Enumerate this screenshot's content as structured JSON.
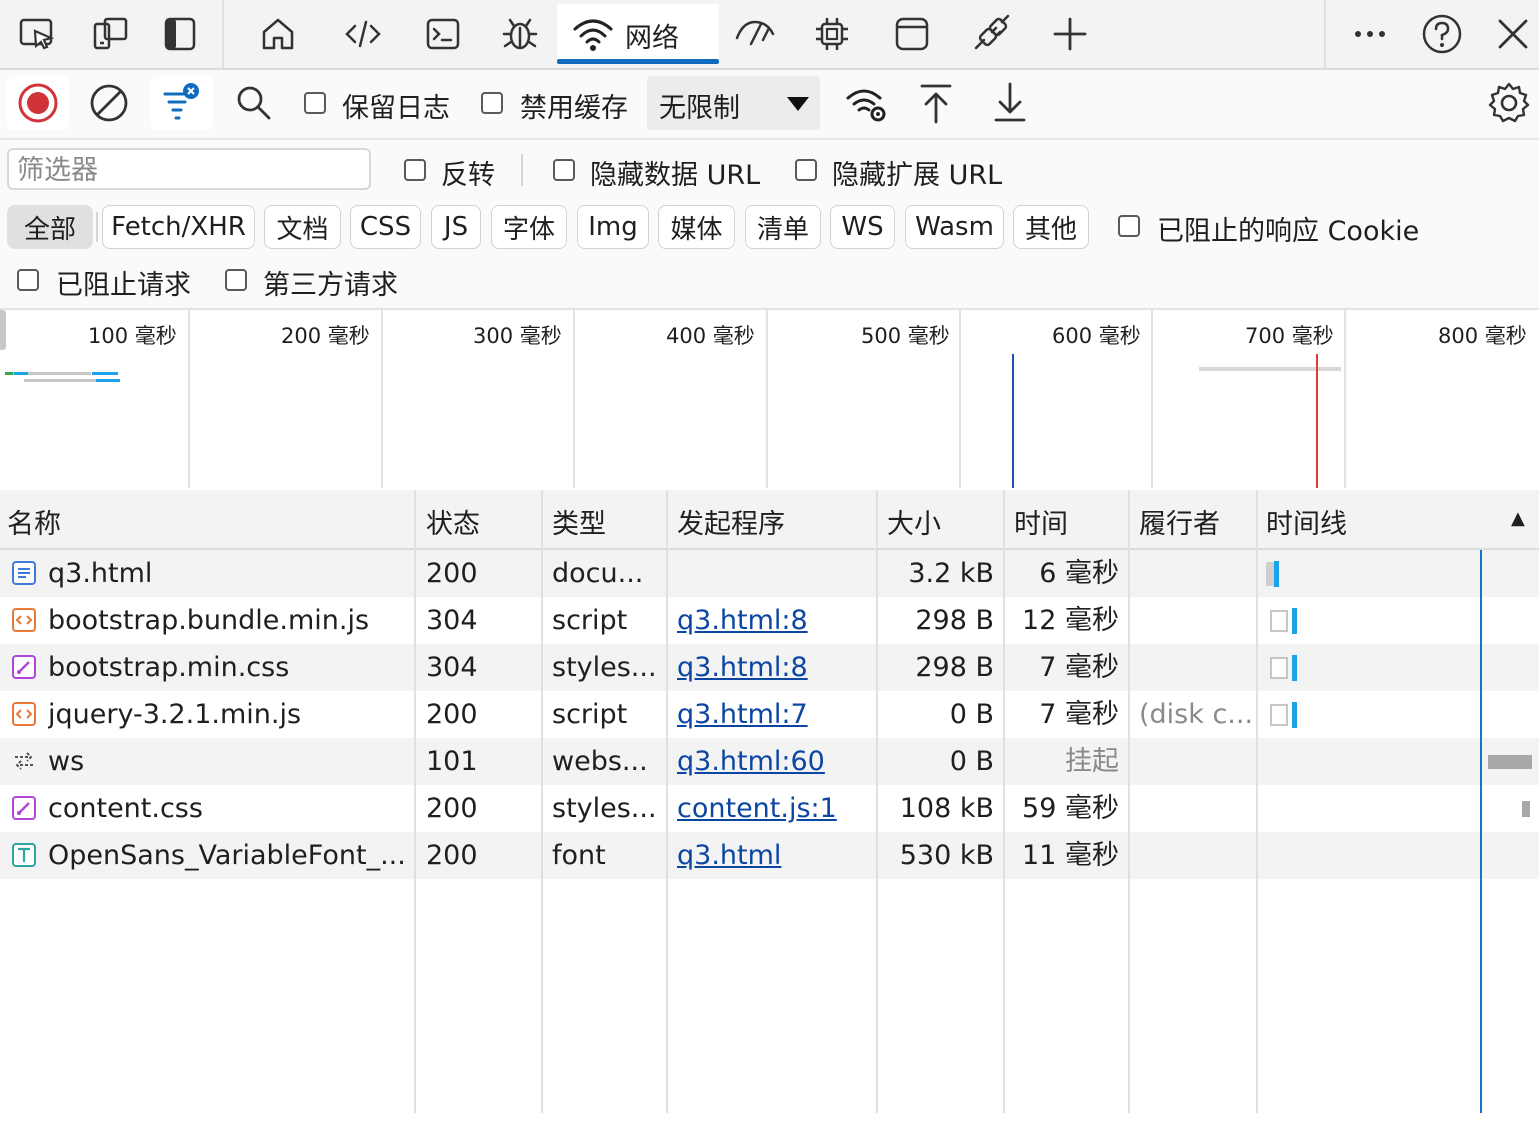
{
  "tabs": {
    "active_label": "网络",
    "icons": [
      "inspect-icon",
      "device-emulation-icon",
      "dock-side-icon",
      "welcome-home-icon",
      "elements-code-icon",
      "console-icon",
      "sources-bug-icon",
      "network-wifi-icon",
      "performance-icon",
      "memory-chip-icon",
      "application-icon",
      "crossorigin-plug-icon",
      "add-tool-icon",
      "more-tools-icon",
      "help-icon",
      "close-icon"
    ]
  },
  "toolbar": {
    "preserve_log": "保留日志",
    "disable_cache": "禁用缓存",
    "throttle_value": "无限制"
  },
  "filter": {
    "placeholder": "筛选器",
    "invert": "反转",
    "hide_data_urls": "隐藏数据 URL",
    "hide_ext_urls": "隐藏扩展 URL",
    "types": [
      "全部",
      "Fetch/XHR",
      "文档",
      "CSS",
      "JS",
      "字体",
      "Img",
      "媒体",
      "清单",
      "WS",
      "Wasm",
      "其他"
    ],
    "active_type": "全部",
    "blocked_cookies": "已阻止的响应 Cookie",
    "blocked_requests": "已阻止请求",
    "third_party": "第三方请求"
  },
  "overview": {
    "ticks": [
      "100 毫秒",
      "200 毫秒",
      "300 毫秒",
      "400 毫秒",
      "500 毫秒",
      "600 毫秒",
      "700 毫秒",
      "800 毫秒"
    ],
    "dom_content_loaded_ms": 600,
    "load_ms": 700
  },
  "table": {
    "columns": [
      "名称",
      "状态",
      "类型",
      "发起程序",
      "大小",
      "时间",
      "履行者",
      "时间线"
    ],
    "sort_indicator": "▲",
    "rows": [
      {
        "name": "q3.html",
        "status": "200",
        "type": "docu...",
        "initiator": "",
        "size": "3.2 kB",
        "time": "6 毫秒",
        "fulfilled": "",
        "icon": "document-icon",
        "icon_color": "#3d7bd9"
      },
      {
        "name": "bootstrap.bundle.min.js",
        "status": "304",
        "type": "script",
        "initiator": "q3.html:8",
        "size": "298 B",
        "time": "12 毫秒",
        "fulfilled": "",
        "icon": "script-icon",
        "icon_color": "#e8773a"
      },
      {
        "name": "bootstrap.min.css",
        "status": "304",
        "type": "styles...",
        "initiator": "q3.html:8",
        "size": "298 B",
        "time": "7 毫秒",
        "fulfilled": "",
        "icon": "stylesheet-icon",
        "icon_color": "#b145d9"
      },
      {
        "name": "jquery-3.2.1.min.js",
        "status": "200",
        "type": "script",
        "initiator": "q3.html:7",
        "size": "0 B",
        "time": "7 毫秒",
        "fulfilled": "(disk c...",
        "icon": "script-icon",
        "icon_color": "#e8773a"
      },
      {
        "name": "ws",
        "status": "101",
        "type": "webs...",
        "initiator": "q3.html:60",
        "size": "0 B",
        "time": "挂起",
        "fulfilled": "",
        "icon": "websocket-icon",
        "icon_color": "#555555"
      },
      {
        "name": "content.css",
        "status": "200",
        "type": "styles...",
        "initiator": "content.js:1",
        "size": "108 kB",
        "time": "59 毫秒",
        "fulfilled": "",
        "icon": "stylesheet-icon",
        "icon_color": "#b145d9"
      },
      {
        "name": "OpenSans_VariableFont_...",
        "status": "200",
        "type": "font",
        "initiator": "q3.html",
        "size": "530 kB",
        "time": "11 毫秒",
        "fulfilled": "",
        "icon": "font-icon",
        "icon_color": "#2aa5a0"
      }
    ]
  },
  "colors": {
    "accent": "#0f6cbd",
    "record_red": "#d13438",
    "link": "#0b46a3",
    "waterfall_blue": "#1aa3e8",
    "load_red": "#e03a3a",
    "dcl_blue": "#1f4fb5"
  }
}
